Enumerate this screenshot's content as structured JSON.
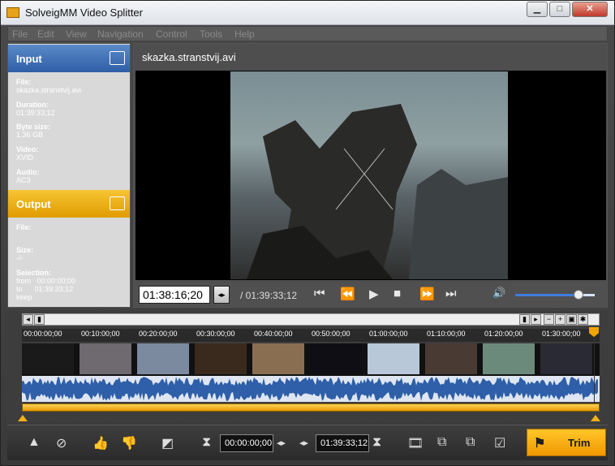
{
  "window": {
    "title": "SolveigMM Video Splitter"
  },
  "menu": [
    "File",
    "Edit",
    "View",
    "Navigation",
    "Control",
    "Tools",
    "Help"
  ],
  "input": {
    "header": "Input",
    "file_label": "File:",
    "file_value": "skazka.stranstvij.avi",
    "duration_label": "Duration:",
    "duration_value": "01:39:33;12",
    "bytesize_label": "Byte size:",
    "bytesize_value": "1.36 GB",
    "video_label": "Video:",
    "video_value": "XVID",
    "audio_label": "Audio:",
    "audio_value": "AC3"
  },
  "output": {
    "header": "Output",
    "file_label": "File:",
    "size_label": "Size:",
    "size_value": "-/-",
    "selection_label": "Selection:",
    "from_label": "from",
    "from_value": "00:00:00;00",
    "to_label": "to",
    "to_value": "01:39:33;12",
    "mode": "keep"
  },
  "player": {
    "filename": "skazka.stranstvij.avi",
    "current_time": "01:38:16;20",
    "total_time": "/ 01:39:33;12",
    "volume_level": 0.78
  },
  "timeline": {
    "ticks": [
      "00:00:00;00",
      "00:10:00;00",
      "00:20:00;00",
      "00:30:00;00",
      "00:40:00;00",
      "00:50:00;00",
      "01:00:00;00",
      "01:10:00;00",
      "01:20:00;00",
      "01:30:00;00"
    ],
    "thumbnail_colors": [
      "#1a1a1a",
      "#6e6a70",
      "#7c8aa0",
      "#3a2a1e",
      "#8a6e52",
      "#0e0e14",
      "#b8c8d8",
      "#4a3a34",
      "#6c8a7c",
      "#2a2a34"
    ]
  },
  "bottom": {
    "start_time": "00:00:00;00",
    "end_time": "01:39:33;12",
    "trim_label": "Trim"
  },
  "colors": {
    "input_header": "#3a6ab4",
    "output_header": "#f0b010",
    "accent": "#f2a500"
  }
}
